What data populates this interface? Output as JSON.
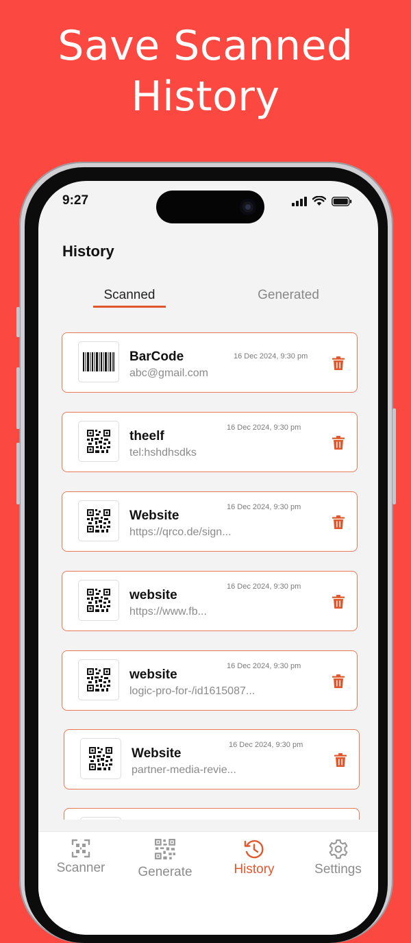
{
  "promo": {
    "line1": "Save Scanned",
    "line2": "History"
  },
  "status_bar": {
    "time": "9:27",
    "icons": [
      "signal-icon",
      "wifi-icon",
      "battery-icon"
    ]
  },
  "page": {
    "title": "History"
  },
  "tabs": [
    {
      "label": "Scanned",
      "active": true
    },
    {
      "label": "Generated",
      "active": false
    }
  ],
  "items": [
    {
      "type": "barcode",
      "title": "BarCode",
      "subtitle": "abc@gmail.com",
      "date": "16 Dec 2024, 9:30 pm"
    },
    {
      "type": "qr",
      "title": "theelf",
      "subtitle": "tel:hshdhsdks",
      "date": "16 Dec 2024, 9:30 pm"
    },
    {
      "type": "qr",
      "title": "Website",
      "subtitle": "https://qrco.de/sign...",
      "date": "16 Dec 2024, 9:30 pm"
    },
    {
      "type": "qr",
      "title": "website",
      "subtitle": "https://www.fb...",
      "date": "16 Dec 2024, 9:30 pm"
    },
    {
      "type": "qr",
      "title": "website",
      "subtitle": "logic-pro-for-/id1615087...",
      "date": "16 Dec 2024, 9:30 pm"
    },
    {
      "type": "qr",
      "title": "Website",
      "subtitle": "partner-media-revie...",
      "date": "16 Dec 2024, 9:30 pm"
    }
  ],
  "nav": [
    {
      "label": "Scanner",
      "icon": "scanner-icon",
      "active": false
    },
    {
      "label": "Generate",
      "icon": "qr-code-icon",
      "active": false
    },
    {
      "label": "History",
      "icon": "history-icon",
      "active": true
    },
    {
      "label": "Settings",
      "icon": "gear-icon",
      "active": false
    }
  ],
  "colors": {
    "background": "#FB4841",
    "accent": "#E2562C",
    "card_border": "#E77A55"
  }
}
